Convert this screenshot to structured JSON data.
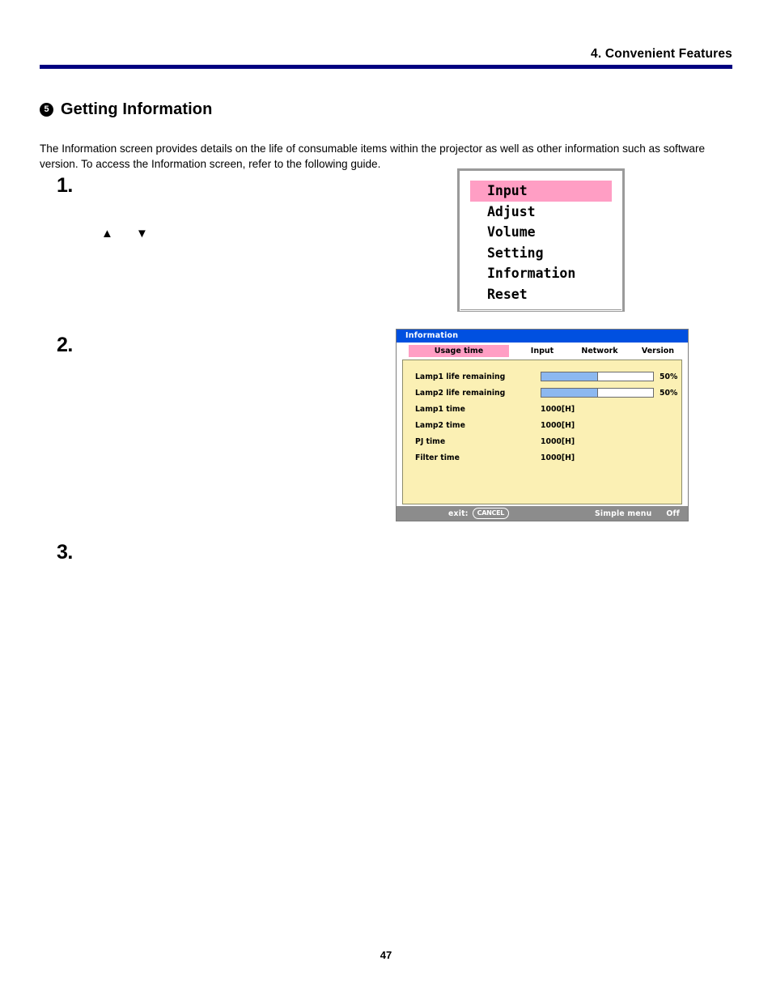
{
  "page_header": {
    "chapter_title": "4. Convenient Features",
    "rule_color": "#000080"
  },
  "section": {
    "bullet": "5",
    "title": "Getting Information",
    "intro": "The Information screen provides details on the life of consumable items within the projector as well as other information such as software version. To access the Information screen, refer to the following guide."
  },
  "steps": [
    {
      "number": "1.",
      "arrows": "▲ ▼"
    },
    {
      "number": "2."
    },
    {
      "number": "3."
    }
  ],
  "osd_menu": {
    "items": [
      {
        "label": "Input",
        "selected": true
      },
      {
        "label": "Adjust",
        "selected": false
      },
      {
        "label": "Volume",
        "selected": false
      },
      {
        "label": "Setting",
        "selected": false
      },
      {
        "label": "Information",
        "selected": false
      },
      {
        "label": "Reset",
        "selected": false
      }
    ],
    "highlight_color": "#ff9ec4",
    "border_color": "#9a9a9a"
  },
  "info_screen": {
    "title": "Information",
    "titlebar_color": "#0050e0",
    "body_color": "#fbf0b4",
    "tabs": [
      {
        "label": "Usage time",
        "active": true
      },
      {
        "label": "Input",
        "active": false
      },
      {
        "label": "Network",
        "active": false
      },
      {
        "label": "Version",
        "active": false
      }
    ],
    "rows": [
      {
        "label": "Lamp1 life remaining",
        "type": "gauge",
        "percent": 50,
        "percent_text": "50%"
      },
      {
        "label": "Lamp2 life remaining",
        "type": "gauge",
        "percent": 50,
        "percent_text": "50%"
      },
      {
        "label": "Lamp1 time",
        "type": "text",
        "value": "1000[H]"
      },
      {
        "label": "Lamp2 time",
        "type": "text",
        "value": "1000[H]"
      },
      {
        "label": "PJ time",
        "type": "text",
        "value": "1000[H]"
      },
      {
        "label": "Filter time",
        "type": "text",
        "value": "1000[H]"
      }
    ],
    "footer": {
      "exit_label": "exit:",
      "exit_key": "CANCEL",
      "simple_menu_label": "Simple menu",
      "simple_menu_value": "Off"
    },
    "gauge_fill_color": "#8cb8f0"
  },
  "page_number": "47"
}
